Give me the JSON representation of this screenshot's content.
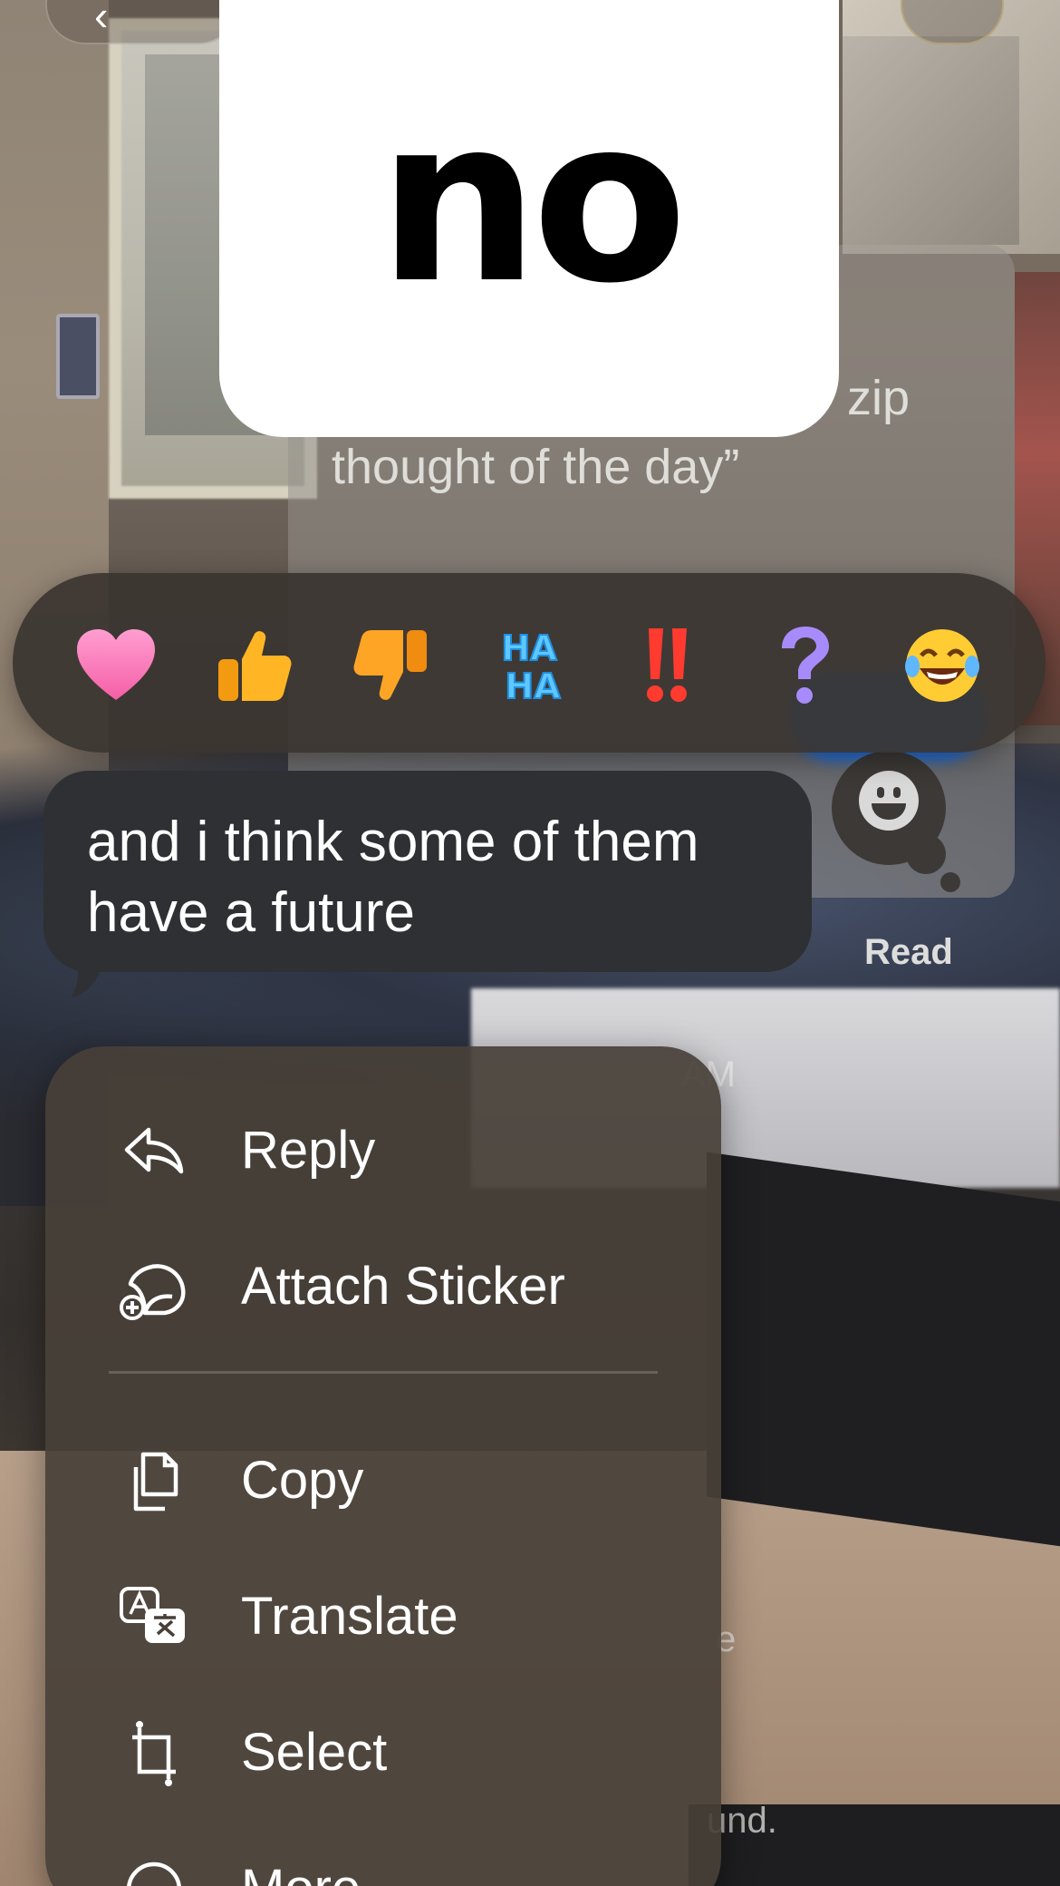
{
  "sticker": {
    "text": "no"
  },
  "thread": {
    "fragment_top": "zip",
    "fragment_line": "thought of the day”",
    "status_read": "Read",
    "time_fragment": "AM",
    "fragment_e": "e",
    "fragment_und": "und."
  },
  "reactions": [
    {
      "name": "heart",
      "glyph": "❤"
    },
    {
      "name": "thumbs-up",
      "glyph": "👍"
    },
    {
      "name": "thumbs-down",
      "glyph": "👎"
    },
    {
      "name": "haha",
      "glyph": "HA HA"
    },
    {
      "name": "exclamation",
      "glyph": "‼"
    },
    {
      "name": "question",
      "glyph": "?"
    },
    {
      "name": "laugh-cry",
      "glyph": "😂"
    }
  ],
  "message": {
    "text": "and i think some of them have a future"
  },
  "menu": {
    "items": [
      {
        "label": "Reply",
        "icon": "reply-icon"
      },
      {
        "label": "Attach Sticker",
        "icon": "sticker-icon"
      },
      {
        "label": "Copy",
        "icon": "copy-icon"
      },
      {
        "label": "Translate",
        "icon": "translate-icon"
      },
      {
        "label": "Select",
        "icon": "select-icon"
      },
      {
        "label": "More",
        "icon": "more-icon"
      }
    ]
  },
  "colors": {
    "menu_bg": "#484038",
    "bubble_bg": "#2e3033",
    "reaction_bar_bg": "#3a3430",
    "heart": "#ff6fb5",
    "thumbs": "#ffb524",
    "haha": "#5fc7ff",
    "exclaim": "#ff3b30",
    "question": "#a78bfa"
  }
}
